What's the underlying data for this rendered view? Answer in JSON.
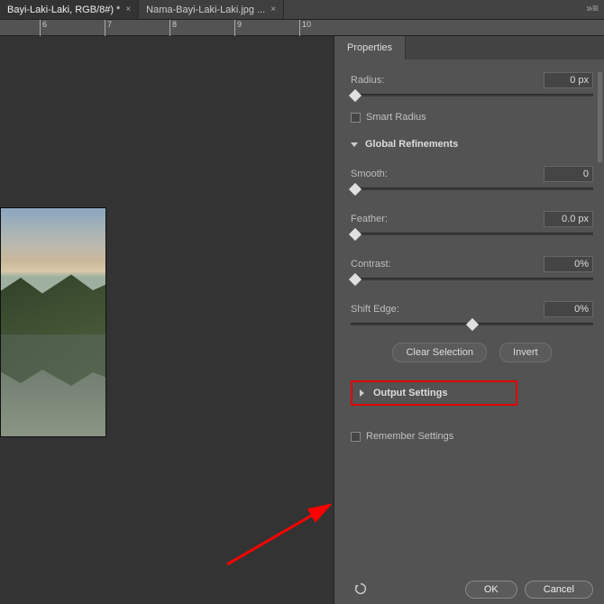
{
  "tabs": {
    "items": [
      {
        "label": "Bayi-Laki-Laki, RGB/8#) *",
        "active": true
      },
      {
        "label": "Nama-Bayi-Laki-Laki.jpg ...",
        "active": false
      }
    ]
  },
  "ruler": {
    "ticks": [
      "6",
      "7",
      "8",
      "9",
      "10"
    ]
  },
  "panel": {
    "tab": "Properties",
    "radius": {
      "label": "Radius:",
      "value": "0 px",
      "thumbPct": 0
    },
    "smartRadius": {
      "label": "Smart Radius",
      "checked": false
    },
    "globalRefinements": {
      "label": "Global Refinements"
    },
    "smooth": {
      "label": "Smooth:",
      "value": "0",
      "thumbPct": 0
    },
    "feather": {
      "label": "Feather:",
      "value": "0.0 px",
      "thumbPct": 0
    },
    "contrast": {
      "label": "Contrast:",
      "value": "0%",
      "thumbPct": 0
    },
    "shiftEdge": {
      "label": "Shift Edge:",
      "value": "0%",
      "thumbPct": 50
    },
    "clearSelection": "Clear Selection",
    "invert": "Invert",
    "outputSettings": {
      "label": "Output Settings"
    },
    "rememberSettings": {
      "label": "Remember Settings",
      "checked": false
    },
    "ok": "OK",
    "cancel": "Cancel"
  }
}
